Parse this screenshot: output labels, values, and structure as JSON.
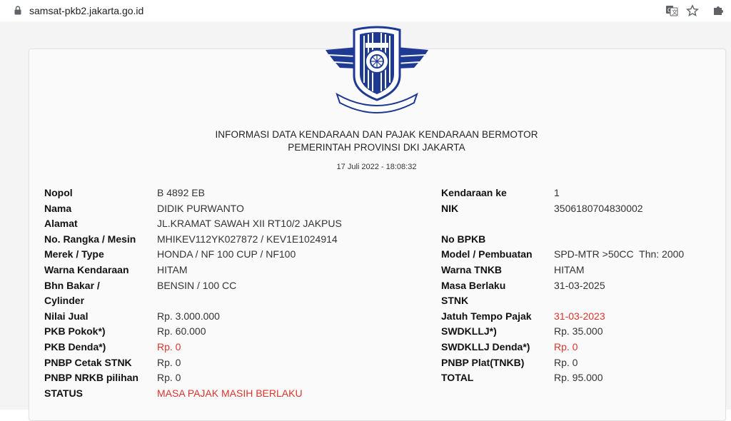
{
  "browser": {
    "url": "samsat-pkb2.jakarta.go.id"
  },
  "header": {
    "logo_text_top": "POLISI",
    "logo_text_ribbon": "Dharmakerta Marga Reksyaka",
    "title_line1": "INFORMASI DATA KENDARAAN DAN PAJAK KENDARAAN BERMOTOR",
    "title_line2": "PEMERINTAH PROVINSI DKI JAKARTA",
    "timestamp": "17 Juli 2022 - 18:08:32"
  },
  "left": {
    "nopol_label": "Nopol",
    "nopol_value": "B 4892 EB",
    "nama_label": "Nama",
    "nama_value": "DIDIK PURWANTO",
    "alamat_label": "Alamat",
    "alamat_value": "JL.KRAMAT SAWAH XII RT10/2 JAKPUS",
    "rangka_label": "No. Rangka / Mesin",
    "rangka_value": "MHIKEV112YK027872 / KEV1E1024914",
    "merek_label": "Merek / Type",
    "merek_value": "HONDA / NF 100 CUP / NF100",
    "warna_label": "Warna Kendaraan",
    "warna_value": "HITAM",
    "bhn_label_1": "Bhn Bakar /",
    "bhn_label_2": "Cylinder",
    "bhn_value": "BENSIN / 100 CC",
    "nilai_label": "Nilai Jual",
    "nilai_value": "Rp. 3.000.000",
    "pkb_pokok_label": "PKB Pokok*)",
    "pkb_pokok_value": "Rp. 60.000",
    "pkb_denda_label": "PKB Denda*)",
    "pkb_denda_value": "Rp. 0",
    "pnbp_stnk_label": "PNBP Cetak STNK",
    "pnbp_stnk_value": "Rp. 0",
    "pnbp_nrkb_label": "PNBP NRKB pilihan",
    "pnbp_nrkb_value": "Rp. 0",
    "status_label": "STATUS",
    "status_value": "MASA PAJAK MASIH BERLAKU"
  },
  "right": {
    "kendaraan_ke_label": "Kendaraan ke",
    "kendaraan_ke_value": "1",
    "nik_label": "NIK",
    "nik_value": "3506180704830002",
    "bpkb_label": "No BPKB",
    "model_label": "Model / Pembuatan",
    "model_value": "SPD-MTR >50CC  Thn: 2000",
    "tnkb_label": "Warna TNKB",
    "tnkb_value": "HITAM",
    "masa_label_1": "Masa Berlaku",
    "masa_label_2": "STNK",
    "masa_value": "31-03-2025",
    "jatuh_label": "Jatuh Tempo Pajak",
    "jatuh_value": "31-03-2023",
    "swdkllj_label": "SWDKLLJ*)",
    "swdkllj_value": "Rp. 35.000",
    "swdkllj_denda_label": "SWDKLLJ Denda*)",
    "swdkllj_denda_value": "Rp. 0",
    "pnbp_plat_label": "PNBP Plat(TNKB)",
    "pnbp_plat_value": "Rp. 0",
    "total_label": "TOTAL",
    "total_value": "Rp. 95.000"
  },
  "colors": {
    "accent_red": "#d9342b",
    "logo_blue": "#1f3a93"
  }
}
